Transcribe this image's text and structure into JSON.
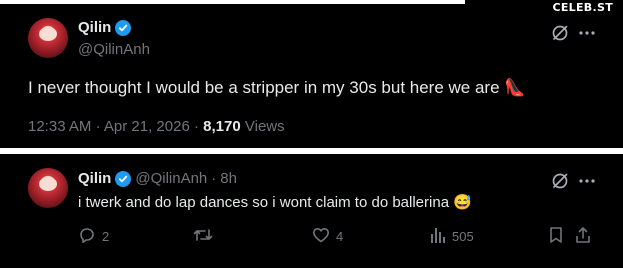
{
  "watermark": "CELEB.ST",
  "main_tweet": {
    "author_name": "Qilin",
    "author_handle": "@QilinAnh",
    "text": "I never thought I would be a stripper in my 30s but here we are",
    "emoji": "👠",
    "time": "12:33 AM",
    "date": "Apr 21, 2026",
    "views_count": "8,170",
    "views_label": "Views",
    "icons": [
      "grok-icon",
      "more-icon",
      "verified-icon"
    ]
  },
  "reply_tweet": {
    "author_name": "Qilin",
    "author_handle": "@QilinAnh",
    "age": "8h",
    "text": "i twerk and do lap dances so i wont claim to do ballerina",
    "emoji": "😅",
    "actions": {
      "replies": "2",
      "reposts": "",
      "likes": "4",
      "views": "505"
    }
  },
  "colors": {
    "background": "#000000",
    "text": "#e7e9ea",
    "muted": "#71767b",
    "verified": "#1d9bf0"
  }
}
